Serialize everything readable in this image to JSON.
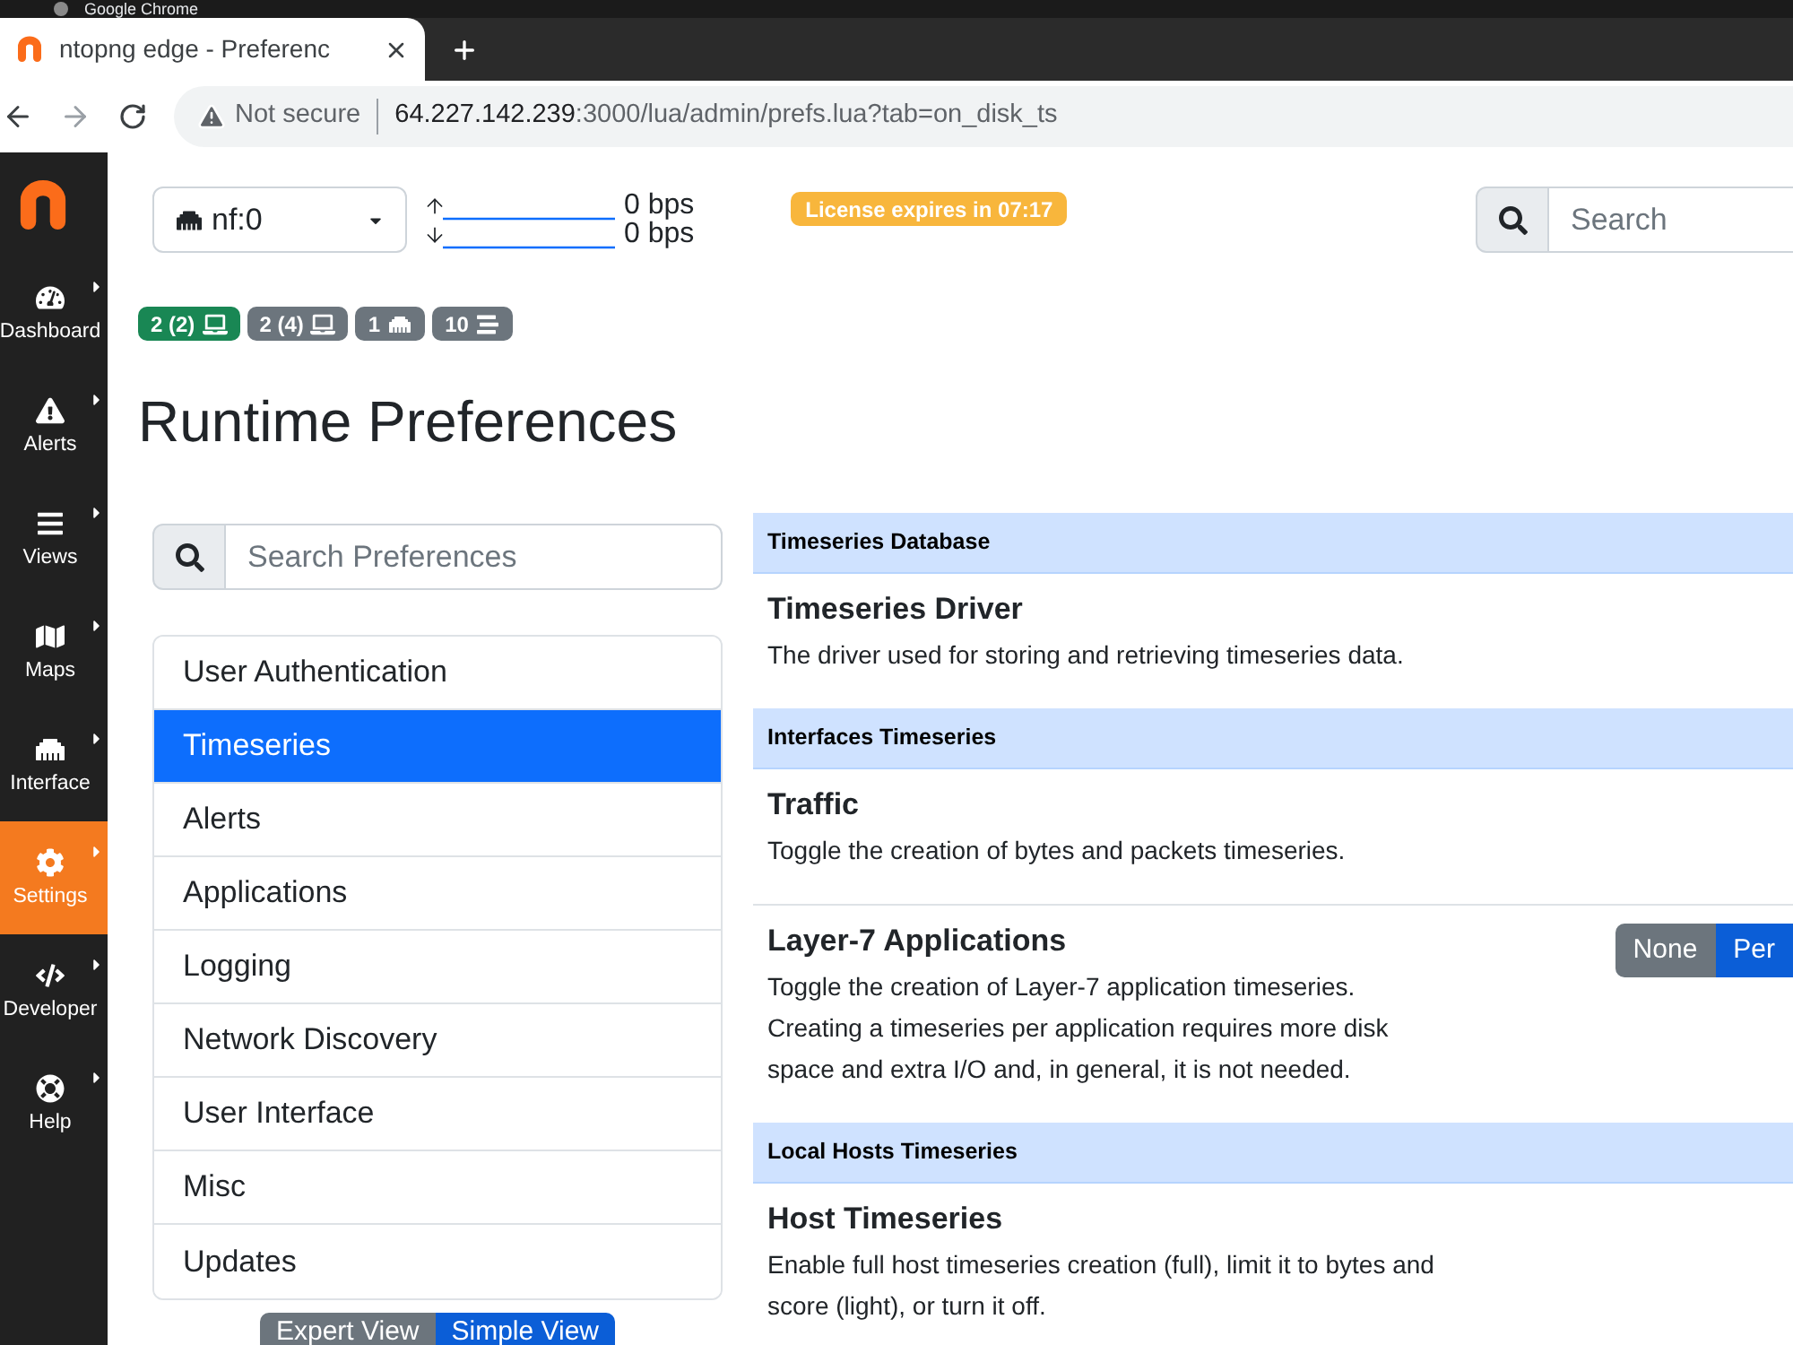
{
  "browser": {
    "app_title": "Google Chrome",
    "tab": {
      "title": "ntopng edge - Preferenc"
    },
    "address": {
      "security": "Not secure",
      "host": "64.227.142.239",
      "path": ":3000/lua/admin/prefs.lua?tab=on_disk_ts"
    }
  },
  "sidebar": {
    "items": [
      {
        "label": "Dashboard",
        "kind": "dashboard",
        "selected": false
      },
      {
        "label": "Alerts",
        "kind": "alerts",
        "selected": false
      },
      {
        "label": "Views",
        "kind": "views",
        "selected": false
      },
      {
        "label": "Maps",
        "kind": "maps",
        "selected": false
      },
      {
        "label": "Interface",
        "kind": "interface",
        "selected": false
      },
      {
        "label": "Settings",
        "kind": "settings",
        "selected": true
      },
      {
        "label": "Developer",
        "kind": "developer",
        "selected": false
      },
      {
        "label": "Help",
        "kind": "help",
        "selected": false
      }
    ]
  },
  "toolbar": {
    "interface": "nf:0",
    "traffic": [
      {
        "kind": "up",
        "reading": "0 bps"
      },
      {
        "kind": "down",
        "reading": "0 bps"
      }
    ],
    "license": "License expires in 07:17",
    "search": {
      "placeholder": "Search"
    }
  },
  "badges": [
    {
      "label": "2 (2)",
      "kind": "laptop",
      "color": "#198754"
    },
    {
      "label": "2 (4)",
      "kind": "laptop",
      "color": "#6c757d"
    },
    {
      "label": "1",
      "kind": "ethernet",
      "color": "#6c757d"
    },
    {
      "label": "10",
      "kind": "list",
      "color": "#6c757d"
    }
  ],
  "page_title": "Runtime Preferences",
  "preferences_search": {
    "placeholder": "Search Preferences"
  },
  "categories": [
    {
      "label": "User Authentication",
      "selected": false
    },
    {
      "label": "Timeseries",
      "selected": true
    },
    {
      "label": "Alerts",
      "selected": false
    },
    {
      "label": "Applications",
      "selected": false
    },
    {
      "label": "Logging",
      "selected": false
    },
    {
      "label": "Network Discovery",
      "selected": false
    },
    {
      "label": "User Interface",
      "selected": false
    },
    {
      "label": "Misc",
      "selected": false
    },
    {
      "label": "Updates",
      "selected": false
    }
  ],
  "view_toggle": [
    {
      "label": "Expert View",
      "selected": false
    },
    {
      "label": "Simple View",
      "selected": true
    }
  ],
  "sections": [
    {
      "title": "Timeseries Database",
      "rows": [
        {
          "title": "Timeseries Driver",
          "description": "The driver used for storing and retrieving timeseries data."
        }
      ]
    },
    {
      "title": "Interfaces Timeseries",
      "rows": [
        {
          "title": "Traffic",
          "description": "Toggle the creation of bytes and packets timeseries."
        },
        {
          "title": "Layer-7 Applications",
          "description": "Toggle the creation of Layer-7 application timeseries.\nCreating a timeseries per application requires more disk space and extra I/O and, in general, it is not needed.",
          "options": [
            {
              "label": "None",
              "selected": false
            },
            {
              "label": "Per",
              "selected": true
            }
          ]
        }
      ]
    },
    {
      "title": "Local Hosts Timeseries",
      "rows": [
        {
          "title": "Host Timeseries",
          "description": "Enable full host timeseries creation (full), limit it to bytes and score (light), or turn it off."
        }
      ]
    }
  ]
}
